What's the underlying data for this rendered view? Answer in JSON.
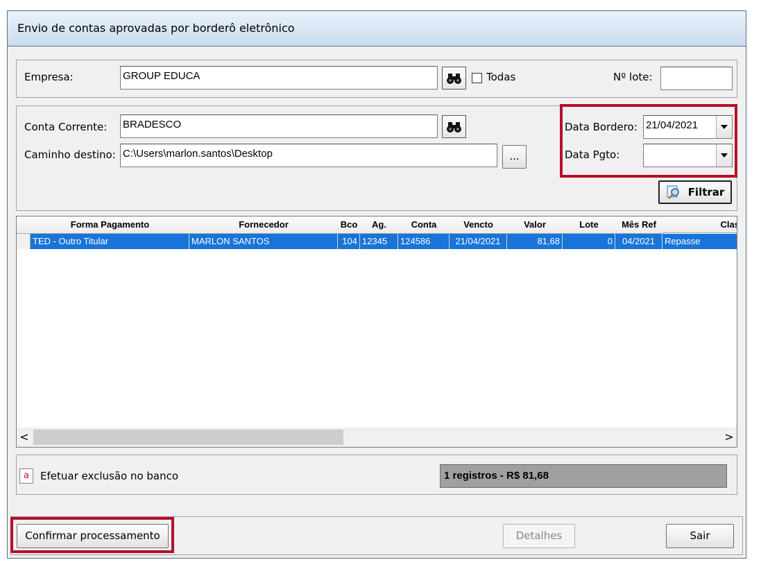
{
  "window": {
    "title": "Envio de contas aprovadas por borderô eletrônico"
  },
  "filters": {
    "empresa_label": "Empresa:",
    "empresa_value": "GROUP EDUCA",
    "todas_label": "Todas",
    "todas_checked": false,
    "lote_label": "Nº lote:",
    "lote_value": "",
    "conta_corrente_label": "Conta Corrente:",
    "conta_corrente_value": "BRADESCO",
    "caminho_label": "Caminho destino:",
    "caminho_value": "C:\\Users\\marlon.santos\\Desktop",
    "browse_label": "...",
    "data_bordero_label": "Data Bordero:",
    "data_bordero_value": "21/04/2021",
    "data_pgto_label": "Data Pgto:",
    "data_pgto_value": "",
    "filtrar_label": "Filtrar"
  },
  "grid": {
    "columns": [
      "Forma Pagamento",
      "Fornecedor",
      "Bco",
      "Ag.",
      "Conta",
      "Vencto",
      "Valor",
      "Lote",
      "Mês Ref",
      "Clas"
    ],
    "rows": [
      [
        "TED - Outro Titular",
        "MARLON SANTOS",
        "104",
        "12345",
        "124586",
        "21/04/2021",
        "81,68",
        "0",
        "04/2021",
        "Repasse"
      ]
    ],
    "selected_row": 0,
    "selection_color": "#1874d8",
    "scroll_left": "<",
    "scroll_right": ">"
  },
  "footer": {
    "exclusao_icon_text": "a",
    "exclusao_label": "Efetuar exclusão no banco",
    "summary": "1 registros - R$ 81,68"
  },
  "actions": {
    "confirmar_label": "Confirmar processamento",
    "detalhes_label": "Detalhes",
    "sair_label": "Sair"
  },
  "colors": {
    "highlight": "#b5102a",
    "summary_bg": "#a0a0a0",
    "title_bar": "#c9dcf0"
  }
}
